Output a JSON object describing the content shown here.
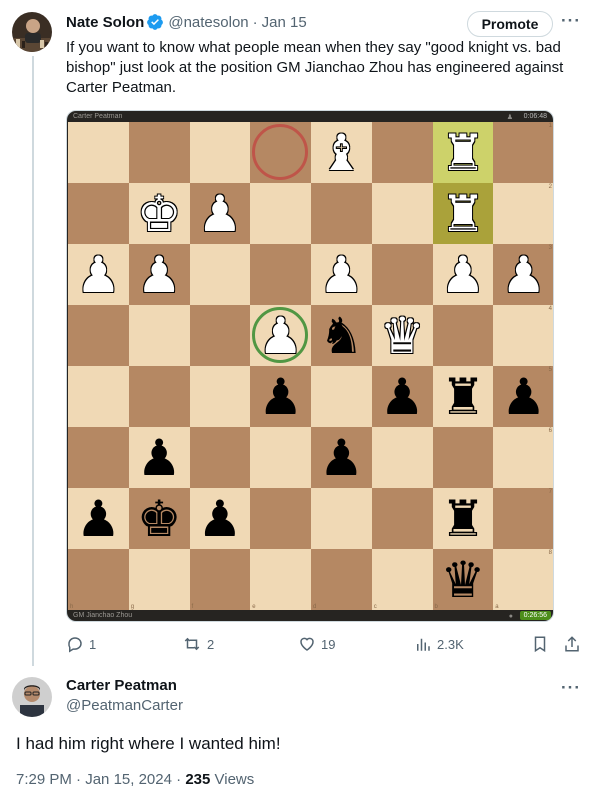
{
  "tweet": {
    "author_name": "Nate Solon",
    "author_handle": "@natesolon",
    "separator": "·",
    "date": "Jan 15",
    "promote_label": "Promote",
    "more_label": "···",
    "text": "If you want to know what people mean when they say \"good knight vs. bad bishop\" just look at the position GM Jianchao Zhou has engineered against Carter Peatman.",
    "verified_color": "#1d9bf0",
    "chess": {
      "top_player": "Carter Peatman",
      "top_clock": "0:06:48",
      "bottom_player": "GM Jianchao Zhou",
      "bottom_clock": "0:26:56",
      "rank_labels": [
        "1",
        "2",
        "3",
        "4",
        "5",
        "6",
        "7",
        "8"
      ],
      "file_labels": [
        "h",
        "g",
        "f",
        "e",
        "d",
        "c",
        "b",
        "a"
      ],
      "board_rows": [
        [
          "",
          "",
          "",
          "",
          "wB",
          "",
          "wR",
          ""
        ],
        [
          "",
          "wK",
          "wP",
          "",
          "",
          "",
          "wR",
          ""
        ],
        [
          "wP",
          "wP",
          "",
          "",
          "wP",
          "",
          "wP",
          "wP"
        ],
        [
          "",
          "",
          "",
          "wP",
          "bN",
          "wQ",
          "",
          ""
        ],
        [
          "",
          "",
          "",
          "bP",
          "",
          "bP",
          "bR",
          "bP"
        ],
        [
          "",
          "bP",
          "",
          "",
          "bP",
          "",
          "",
          ""
        ],
        [
          "bP",
          "bK",
          "bP",
          "",
          "",
          "",
          "bR",
          ""
        ],
        [
          "",
          "",
          "",
          "",
          "",
          "",
          "bQ",
          ""
        ]
      ],
      "highlighted_squares": [
        "b1",
        "b2"
      ],
      "red_ring": "e1",
      "green_ring": "e4",
      "colors": {
        "light": "#f0d9b5",
        "dark": "#b58863"
      }
    },
    "stats": {
      "replies": "1",
      "reposts": "2",
      "likes": "19",
      "views": "2.3K"
    }
  },
  "reply": {
    "author_name": "Carter Peatman",
    "author_handle": "@PeatmanCarter",
    "more_label": "···",
    "text": "I had him right where I wanted him!",
    "time": "7:29 PM",
    "separator": "·",
    "date": "Jan 15, 2024",
    "separator2": "·",
    "views_count": "235",
    "views_label": "Views"
  }
}
